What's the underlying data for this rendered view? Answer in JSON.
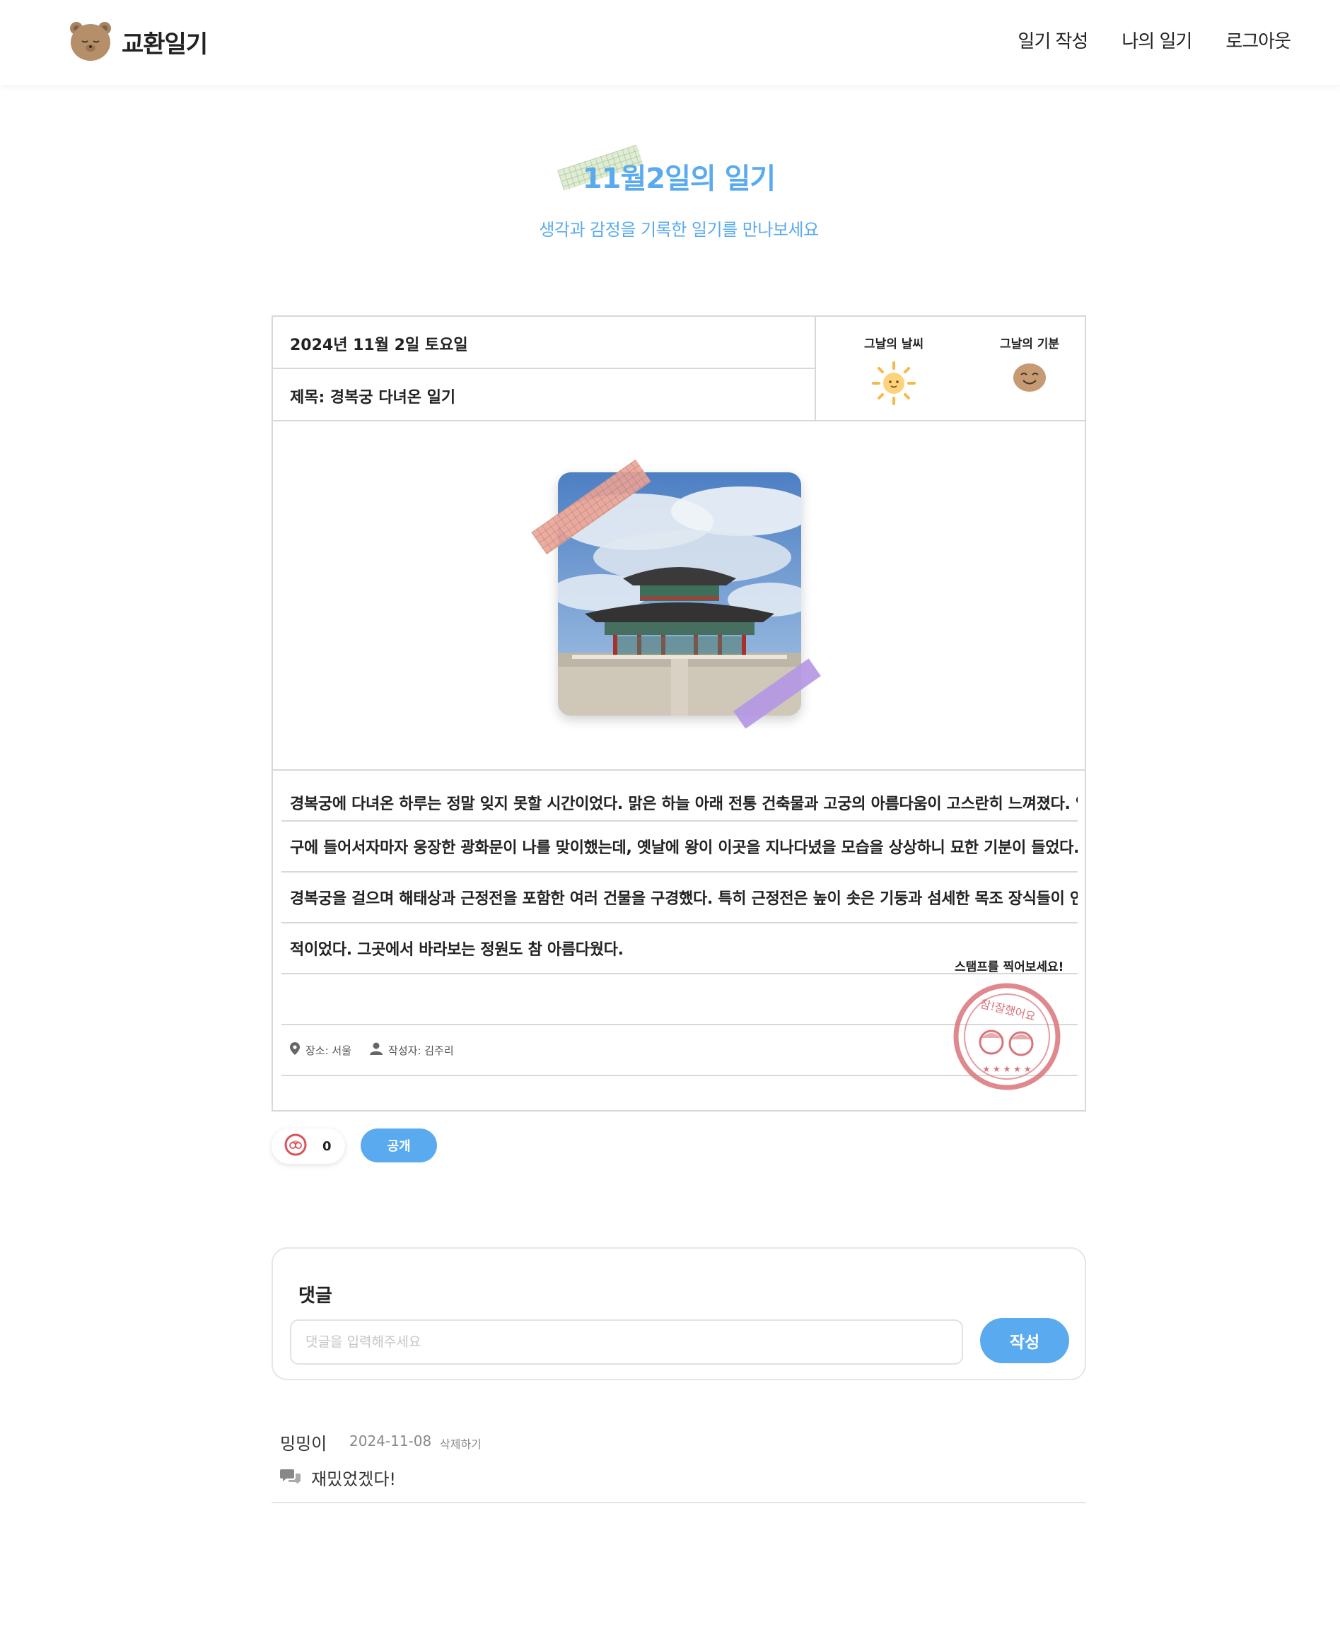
{
  "header": {
    "brand": "교환일기",
    "nav": [
      "일기 작성",
      "나의 일기",
      "로그아웃"
    ]
  },
  "hero": {
    "title": "11월2일의 일기",
    "subtitle": "생각과 감정을 기록한 일기를 만나보세요"
  },
  "diary": {
    "date": "2024년 11월 2일 토요일",
    "title": "제목: 경복궁 다녀온 일기",
    "weather_label": "그날의 날씨",
    "mood_label": "그날의 기분",
    "weather_icon": "sun-icon",
    "mood_icon": "happy-face-icon",
    "lines": [
      "경복궁에 다녀온 하루는 정말 잊지 못할 시간이었다. 맑은 하늘 아래 전통 건축물과 고궁의 아름다움이 고스란히 느껴졌다. 입",
      "구에 들어서자마자 웅장한 광화문이 나를 맞이했는데, 옛날에 왕이 이곳을 지나다녔을 모습을 상상하니 묘한 기분이 들었다.",
      "경복궁을 걸으며 해태상과 근정전을 포함한 여러 건물을 구경했다. 특히 근정전은 높이 솟은 기둥과 섬세한 목조 장식들이 인상",
      "적이었다. 그곳에서 바라보는 정원도 참 아름다웠다.",
      ""
    ],
    "location": "장소: 서울",
    "author": "작성자: 김주리",
    "stamp_prompt": "스탬프를 찍어보세요!",
    "stamp_text": "참!잘했어요"
  },
  "actions": {
    "like_count": "0",
    "visibility_label": "공개"
  },
  "comments": {
    "heading": "댓글",
    "placeholder": "댓글을 입력해주세요",
    "submit_label": "작성",
    "items": [
      {
        "author": "밍밍이",
        "date": "2024-11-08",
        "delete_label": "삭제하기",
        "text": "재밌었겠다!"
      }
    ]
  },
  "colors": {
    "accent": "#5aaaf0",
    "border": "#d8d8d8",
    "stamp": "#d9737a"
  }
}
